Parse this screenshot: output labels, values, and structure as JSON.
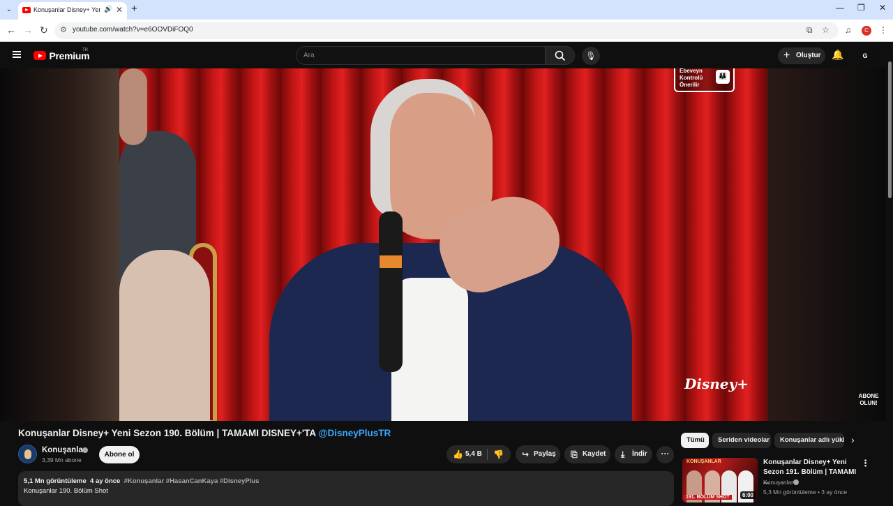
{
  "browser": {
    "tab_title": "Konuşanlar Disney+ Yeni Sezon",
    "url": "youtube.com/watch?v=e6OOVDiFOQ0",
    "profile_initial": "C"
  },
  "header": {
    "logo_text": "Premium",
    "logo_region": "TR",
    "search_placeholder": "Ara",
    "create_label": "Oluştur",
    "avatar_initial": "G"
  },
  "video": {
    "overlay_parental": "Ebeveyn Kontrolü Önerilir",
    "overlay_brand": "Disney+",
    "overlay_subscribe": "ABONE OLUN!"
  },
  "watch": {
    "title": "Konuşanlar Disney+ Yeni Sezon 190. Bölüm | TAMAMI DISNEY+'TA ",
    "title_mention": "@DisneyPlusTR",
    "channel_name": "Konuşanlar",
    "subscribers": "3,39 Mn abone",
    "subscribe_label": "Abone ol",
    "likes": "5,4 B",
    "share_label": "Paylaş",
    "save_label": "Kaydet",
    "download_label": "İndir",
    "views": "5,1 Mn görüntüleme",
    "age": "4 ay önce",
    "hashtags": "#Konuşanlar #HasanCanKaya #DisneyPlus",
    "description_line": "Konuşanlar 190. Bölüm Shot"
  },
  "sidebar": {
    "chips": [
      "Tümü",
      "Seriden videolar",
      "Konuşanlar adlı yükleyiciden"
    ],
    "recommendations": [
      {
        "title": "Konuşanlar Disney+ Yeni Sezon 191. Bölüm | TAMAMI ...",
        "channel": "Konuşanlar",
        "meta": "5,3 Mn görüntüleme • 3 ay önce",
        "duration": "6:00",
        "thumb_title": "KONUŞANLAR",
        "thumb_badge": "191. BÖLÜM SHOT"
      }
    ]
  },
  "colors": {
    "accent_red": "#ff0000",
    "link_blue": "#3ea6ff",
    "background": "#0f0f0f"
  }
}
